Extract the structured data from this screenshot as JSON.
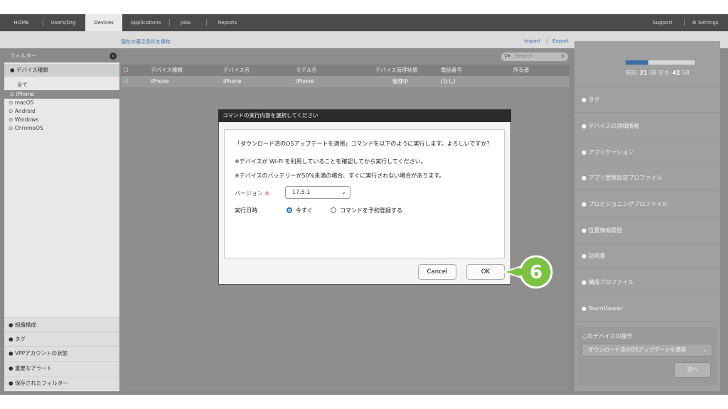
{
  "nav": {
    "tabs": [
      "HOME",
      "Users/Org",
      "Devices",
      "Applications",
      "Jobs",
      "Reports"
    ],
    "support": "Support",
    "settings": "Settings"
  },
  "toolbar": {
    "save_view": "現在の表示条件を保存",
    "import": "Import",
    "export": "Export",
    "separator": "|"
  },
  "filter": {
    "title": "フィルター",
    "device_type_header": "デバイス種類",
    "items": [
      "全て",
      "iPhone",
      "macOS",
      "Android",
      "Windows",
      "ChromeOS"
    ],
    "selected": "iPhone",
    "bottom_sections": [
      "組織構成",
      "タグ",
      "VPPアカウントの状態",
      "重要なアラート",
      "保存されたフィルター"
    ]
  },
  "search": {
    "placeholder": "Search"
  },
  "table": {
    "headers": [
      "デバイス種類",
      "デバイス名",
      "モデル名",
      "デバイス管理状態",
      "電話番号",
      "所有者"
    ],
    "rows": [
      {
        "type": "iPhone",
        "name": "iPhone",
        "model": "iPhone",
        "status": "管理中",
        "phone": "(なし)",
        "owner": ""
      }
    ]
  },
  "right": {
    "storage_used_label": "使用:",
    "storage_used": "21",
    "storage_free_label": "空き:",
    "storage_free": "42",
    "unit": "GB",
    "storage_fill": 0.33,
    "sections": [
      "タグ",
      "デバイスの詳細情報",
      "アプリケーション",
      "アプリ管理設定プロファイル",
      "プロビジョニングプロファイル",
      "位置情報履歴",
      "証明書",
      "構成プロファイル",
      "TeamViewer"
    ],
    "action_title": "このデバイスの操作",
    "action_select": "ダウンロード済のOSアップデートを適用",
    "next_button": "次へ"
  },
  "dialog": {
    "title": "コマンドの実行内容を選択してください",
    "line1": "「ダウンロード済のOSアップデートを適用」コマンドを以下のように実行します。よろしいですか？",
    "line2": "※デバイスが Wi-Fi を利用していることを確認してから実行してください。",
    "line3": "※デバイスのバッテリーが50%未満の場合、すぐに実行されない場合があります。",
    "version_label": "バージョン",
    "required_mark": "※",
    "version_value": "17.5.1",
    "schedule_label": "実行日時",
    "now_label": "今すぐ",
    "reserve_label": "コマンドを予約登録する",
    "cancel": "Cancel",
    "ok": "OK"
  },
  "step_badge": "6",
  "colors": {
    "badge": "#7cc242",
    "accent_link": "#3a6fa6",
    "nav_bg": "#4b4b4b"
  }
}
